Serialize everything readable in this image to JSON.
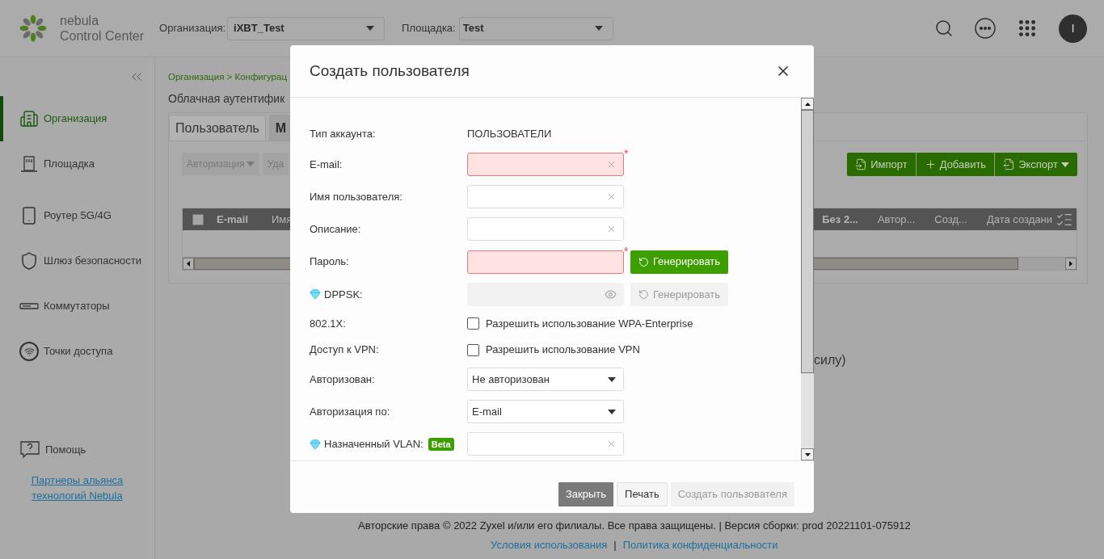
{
  "header": {
    "logo": {
      "line1": "nebula",
      "line2": "Control Center"
    },
    "org": {
      "label": "Организация:",
      "value": "iXBT_Test"
    },
    "site": {
      "label": "Площадка:",
      "value": "Test"
    },
    "avatar": "I"
  },
  "sidebar": {
    "items": [
      {
        "label": "Организация",
        "kind": "building",
        "selected": true
      },
      {
        "label": "Площадка",
        "kind": "site",
        "selected": false
      },
      {
        "label": "Роутер 5G/4G",
        "kind": "phone",
        "selected": false
      },
      {
        "label": "Шлюз безопасности",
        "kind": "shield",
        "selected": false
      },
      {
        "label": "Коммутаторы",
        "kind": "switch",
        "selected": false
      },
      {
        "label": "Точки доступа",
        "kind": "wifi",
        "selected": false
      }
    ],
    "help": "Помощь",
    "partner_link": [
      "Партнеры альянса",
      "технологий Nebula"
    ]
  },
  "content": {
    "breadcrumb": "Организация > Конфигурац",
    "title": "Облачная аутентифик",
    "tabs": [
      {
        "label": "Пользователь",
        "selected": true
      },
      {
        "label": "М",
        "selected": false
      }
    ],
    "toolbar_left": [
      {
        "label": "Авторизация",
        "dropdown": true
      },
      {
        "label": "Уда",
        "dropdown": false
      }
    ],
    "toolbar_right": [
      {
        "label": "Импорт",
        "kind": "import",
        "dropdown": false
      },
      {
        "label": "Добавить",
        "kind": "add",
        "dropdown": false
      },
      {
        "label": "Экспорт",
        "kind": "export",
        "dropdown": true
      }
    ],
    "table": {
      "select_all": {
        "checked": false
      },
      "columns_left": [
        "E-mail",
        "Имя"
      ],
      "columns_right": [
        "Без 2...",
        "Автор...",
        "Созд...",
        "Дата создани"
      ]
    },
    "note": "силу)"
  },
  "modal": {
    "title": "Создать пользователя",
    "required_mark": "*",
    "fields": [
      {
        "kind": "text",
        "label": "Тип аккаунта:",
        "value": "ПОЛЬЗОВАТЕЛИ"
      },
      {
        "kind": "input",
        "label": "E-mail:",
        "required": true
      },
      {
        "kind": "input",
        "label": "Имя пользователя:",
        "required": false
      },
      {
        "kind": "input",
        "label": "Описание:",
        "required": false
      },
      {
        "kind": "password",
        "label": "Пароль:",
        "required": true,
        "button": "Генерировать",
        "disabled": false
      },
      {
        "kind": "password",
        "label": "DPPSK:",
        "premium": true,
        "required": false,
        "button": "Генерировать",
        "disabled": true
      },
      {
        "kind": "checkbox",
        "label": "802.1X:",
        "text": "Разрешить использование WPA-Enterprise",
        "checked": false
      },
      {
        "kind": "checkbox",
        "label": "Доступ к VPN:",
        "text": "Разрешить использование VPN",
        "checked": false
      },
      {
        "kind": "select",
        "label": "Авторизован:",
        "value": "Не авторизован"
      },
      {
        "kind": "select",
        "label": "Авторизация по:",
        "value": "E-mail"
      },
      {
        "kind": "input",
        "label": "Назначенный VLAN:",
        "premium": true,
        "badge": "Beta",
        "required": false
      }
    ],
    "buttons": [
      {
        "label": "Закрыть",
        "kind": "dark",
        "disabled": false
      },
      {
        "label": "Печать",
        "kind": "light",
        "disabled": false
      },
      {
        "label": "Создать пользователя",
        "kind": "primary",
        "disabled": true
      }
    ]
  },
  "footer": {
    "copyright": "Авторские права © 2022 Zyxel и/или его филиалы. Все права защищены. | Версия сборки: prod 20221101-075912",
    "links": [
      "Условия использования",
      "Политика конфиденциальности"
    ],
    "separator": "|"
  }
}
